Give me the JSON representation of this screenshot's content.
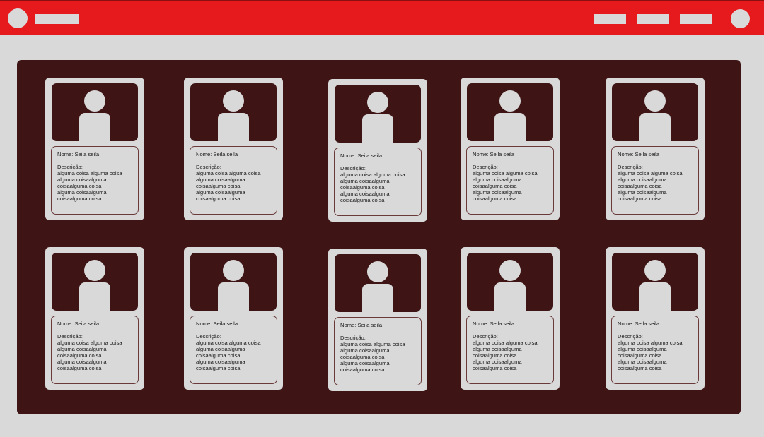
{
  "header": {
    "logo_icon": "circle-icon",
    "avatar_icon": "user-circle-icon"
  },
  "cards": [
    {
      "name": "Nome: Seila seila",
      "desc_label": "Descrição:",
      "desc": "alguma coisa alguma coisa\nalguma coisaalguma\ncoisaalguma coisa\nalguma coisaalguma\ncoisaalguma coisa"
    },
    {
      "name": "Nome: Seila seila",
      "desc_label": "Descrição:",
      "desc": "alguma coisa alguma coisa\nalguma coisaalguma\ncoisaalguma coisa\nalguma coisaalguma\ncoisaalguma coisa"
    },
    {
      "name": "Nome: Seila seila",
      "desc_label": "Descrição:",
      "desc": "alguma coisa alguma coisa\nalguma coisaalguma\ncoisaalguma coisa\nalguma coisaalguma\ncoisaalguma coisa"
    },
    {
      "name": "Nome: Seila seila",
      "desc_label": "Descrição:",
      "desc": "alguma coisa alguma coisa\nalguma coisaalguma\ncoisaalguma coisa\nalguma coisaalguma\ncoisaalguma coisa"
    },
    {
      "name": "Nome: Seila seila",
      "desc_label": "Descrição:",
      "desc": "alguma coisa alguma coisa\nalguma coisaalguma\ncoisaalguma coisa\nalguma coisaalguma\ncoisaalguma coisa"
    },
    {
      "name": "Nome: Seila seila",
      "desc_label": "Descrição:",
      "desc": "alguma coisa alguma coisa\nalguma coisaalguma\ncoisaalguma coisa\nalguma coisaalguma\ncoisaalguma coisa"
    },
    {
      "name": "Nome: Seila seila",
      "desc_label": "Descrição:",
      "desc": "alguma coisa alguma coisa\nalguma coisaalguma\ncoisaalguma coisa\nalguma coisaalguma\ncoisaalguma coisa"
    },
    {
      "name": "Nome: Seila seila",
      "desc_label": "Descrição:",
      "desc": "alguma coisa alguma coisa\nalguma coisaalguma\ncoisaalguma coisa\nalguma coisaalguma\ncoisaalguma coisa"
    },
    {
      "name": "Nome: Seila seila",
      "desc_label": "Descrição:",
      "desc": "alguma coisa alguma coisa\nalguma coisaalguma\ncoisaalguma coisa\nalguma coisaalguma\ncoisaalguma coisa"
    },
    {
      "name": "Nome: Seila seila",
      "desc_label": "Descrição:",
      "desc": "alguma coisa alguma coisa\nalguma coisaalguma\ncoisaalguma coisa\nalguma coisaalguma\ncoisaalguma coisa"
    }
  ],
  "colors": {
    "header": "#e61a1d",
    "panel": "#3e1414",
    "card": "#d9d9d9"
  }
}
